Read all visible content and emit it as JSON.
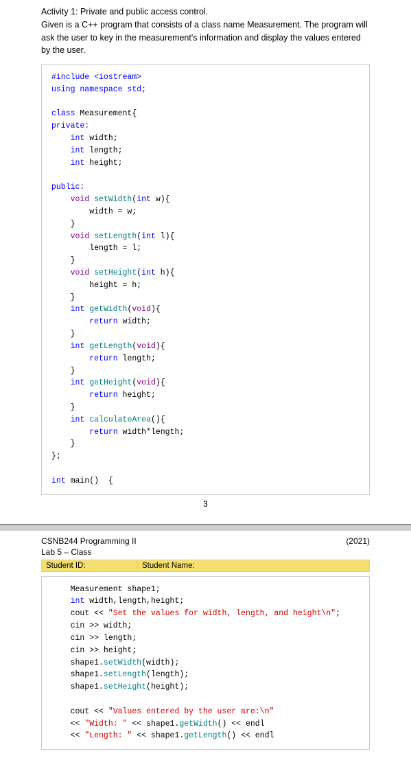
{
  "top": {
    "intro": "Activity 1: Private and public access control.",
    "intro2": "Given is a C++ program that consists of a class name Measurement. The program will ask the user to key in the measurement's information and display the values entered by the user.",
    "code_lines": [
      {
        "text": "#include <iostream>",
        "type": "preprocessor"
      },
      {
        "text": "using namespace std;",
        "type": "using"
      },
      {
        "text": "",
        "type": "blank"
      },
      {
        "text": "class Measurement{",
        "type": "class"
      },
      {
        "text": "private:",
        "type": "access"
      },
      {
        "text": "    int width;",
        "type": "member"
      },
      {
        "text": "    int length;",
        "type": "member"
      },
      {
        "text": "    int height;",
        "type": "member"
      },
      {
        "text": "",
        "type": "blank"
      },
      {
        "text": "public:",
        "type": "access"
      },
      {
        "text": "    void setWidth(int w){",
        "type": "method"
      },
      {
        "text": "        width = w;",
        "type": "body"
      },
      {
        "text": "    }",
        "type": "body"
      },
      {
        "text": "    void setLength(int l){",
        "type": "method"
      },
      {
        "text": "        length = l;",
        "type": "body"
      },
      {
        "text": "    }",
        "type": "body"
      },
      {
        "text": "    void setHeight(int h){",
        "type": "method"
      },
      {
        "text": "        height = h;",
        "type": "body"
      },
      {
        "text": "    }",
        "type": "body"
      },
      {
        "text": "    int getWidth(void){",
        "type": "method"
      },
      {
        "text": "        return width;",
        "type": "return"
      },
      {
        "text": "    }",
        "type": "body"
      },
      {
        "text": "    int getLength(void){",
        "type": "method"
      },
      {
        "text": "        return length;",
        "type": "return"
      },
      {
        "text": "    }",
        "type": "body"
      },
      {
        "text": "    int getHeight(void){",
        "type": "method"
      },
      {
        "text": "        return height;",
        "type": "return"
      },
      {
        "text": "    }",
        "type": "body"
      },
      {
        "text": "    int calculateArea(){",
        "type": "method"
      },
      {
        "text": "        return width*length;",
        "type": "return"
      },
      {
        "text": "    }",
        "type": "body"
      },
      {
        "text": "};",
        "type": "body"
      },
      {
        "text": "",
        "type": "blank"
      },
      {
        "text": "int main()  {",
        "type": "main"
      }
    ],
    "page_number": "3"
  },
  "bottom": {
    "course": "CSNB244 Programming II",
    "year": "(2021)",
    "lab": "Lab 5 – Class",
    "student_id_label": "Student ID:",
    "student_name_label": "Student Name:",
    "code_lines": [
      {
        "text": "    Measurement shape1;",
        "type": "normal"
      },
      {
        "text": "    int width,length,height;",
        "type": "int-kw"
      },
      {
        "text": "    cout << \"Set the values for width, length, and height\\n\";",
        "type": "cout"
      },
      {
        "text": "    cin >> width;",
        "type": "cin"
      },
      {
        "text": "    cin >> length;",
        "type": "cin"
      },
      {
        "text": "    cin >> height;",
        "type": "cin"
      },
      {
        "text": "    shape1.setWidth(width);",
        "type": "method-call"
      },
      {
        "text": "    shape1.setLength(length);",
        "type": "method-call"
      },
      {
        "text": "    shape1.setHeight(height);",
        "type": "method-call"
      },
      {
        "text": "",
        "type": "blank"
      },
      {
        "text": "    cout << \"Values entered by the user are:\\n\"",
        "type": "cout"
      },
      {
        "text": "    << \"Width: \" << shape1.getWidth() << endl",
        "type": "cout2"
      },
      {
        "text": "    << \"Length: \" << shape1.getLength() << endl",
        "type": "cout2"
      }
    ]
  }
}
